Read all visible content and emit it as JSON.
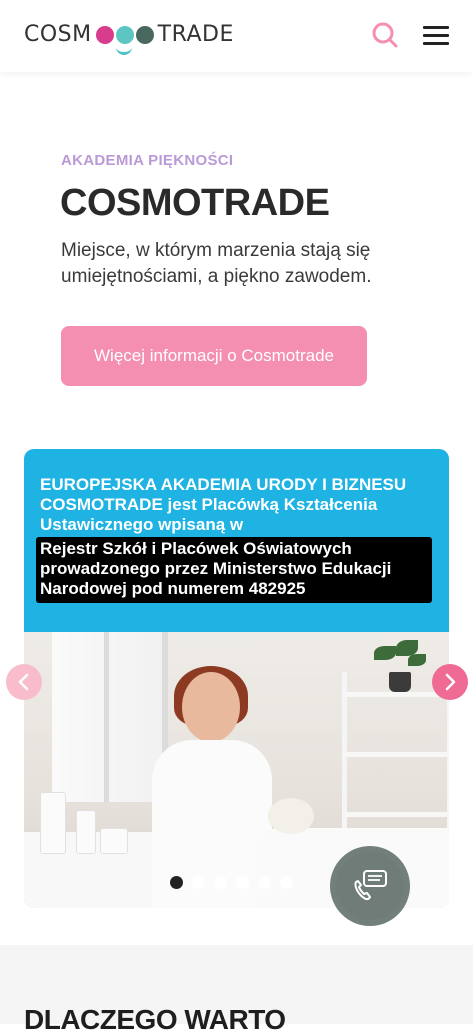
{
  "header": {
    "logo_left": "COSM",
    "logo_right": "TRADE",
    "logo_colors": [
      "#d83c8d",
      "#5ec6c2",
      "#486860"
    ]
  },
  "hero": {
    "subtitle": "AKADEMIA PIĘKNOŚCI",
    "title": "COSMOTRADE",
    "description": "Miejsce, w którym marzenia stają się umiejętnościami, a piękno zawodem.",
    "cta_label": "Więcej informacji o Cosmotrade",
    "accent_color": "#f48fb1"
  },
  "slider": {
    "line1": "EUROPEJSKA AKADEMIA URODY I BIZNESU COSMOTRADE jest Placówką Kształcenia Ustawicznego wpisaną w",
    "line2": "Rejestr Szkół i Placówek Oświatowych prowadzonego przez Ministerstwo Edukacji Narodowej pod numerem 482925",
    "slide_count": 6,
    "active_slide": 1,
    "prev_icon": "chevron-left-icon",
    "next_icon": "chevron-right-icon"
  },
  "chat": {
    "icon": "chat-phone-icon"
  },
  "section": {
    "heading": "DLACZEGO WARTO"
  }
}
